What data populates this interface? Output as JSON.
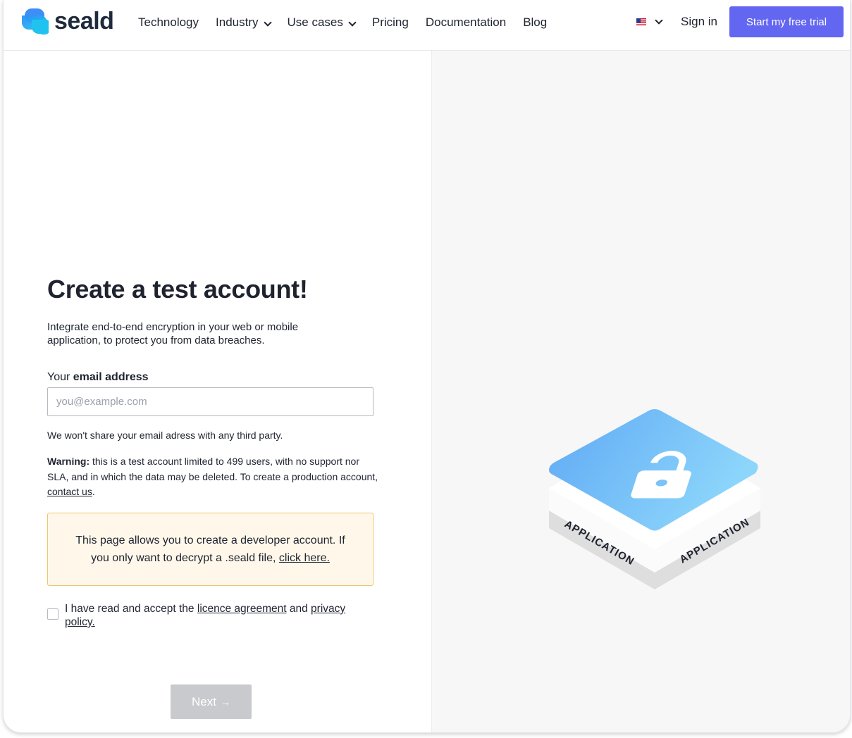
{
  "header": {
    "logo_text": "seald",
    "nav": [
      {
        "label": "Technology",
        "has_dropdown": false
      },
      {
        "label": "Industry",
        "has_dropdown": true
      },
      {
        "label": "Use cases",
        "has_dropdown": true
      },
      {
        "label": "Pricing",
        "has_dropdown": false
      },
      {
        "label": "Documentation",
        "has_dropdown": false
      },
      {
        "label": "Blog",
        "has_dropdown": false
      }
    ],
    "language_icon": "us-flag-icon",
    "signin_label": "Sign in",
    "trial_label": "Start my free trial"
  },
  "form": {
    "title": "Create a test account!",
    "subtitle": "Integrate end-to-end encryption in your web or mobile application, to protect you from data breaches.",
    "email_label_prefix": "Your",
    "email_label_bold": "email address",
    "email_placeholder": "you@example.com",
    "email_value": "",
    "privacy_note": "We won't share your email adress with any third party.",
    "warning_bold": "Warning:",
    "warning_text": "this is a test account limited to 499 users, with no support nor SLA, and in which the data may be deleted. To create a production account,",
    "warning_link": "contact us",
    "warning_end": ".",
    "notice_text": "This page allows you to create a developer account. If you only want to decrypt a .seald file,",
    "notice_link": "click here.",
    "consent_prefix": "I have read and accept the",
    "consent_link1": "licence agreement",
    "consent_mid": "and",
    "consent_link2": "privacy policy.",
    "consent_checked": false,
    "next_label": "Next",
    "next_arrow": "→"
  },
  "illustration": {
    "left_label": "APPLICATION",
    "right_label": "APPLICATION",
    "icon": "lock-icon"
  },
  "colors": {
    "accent": "#6366f1",
    "notice_bg": "#fff8ea",
    "notice_border": "#f0c570",
    "disabled_button": "#c9cacd",
    "panel_bg": "#f7f7f7"
  }
}
